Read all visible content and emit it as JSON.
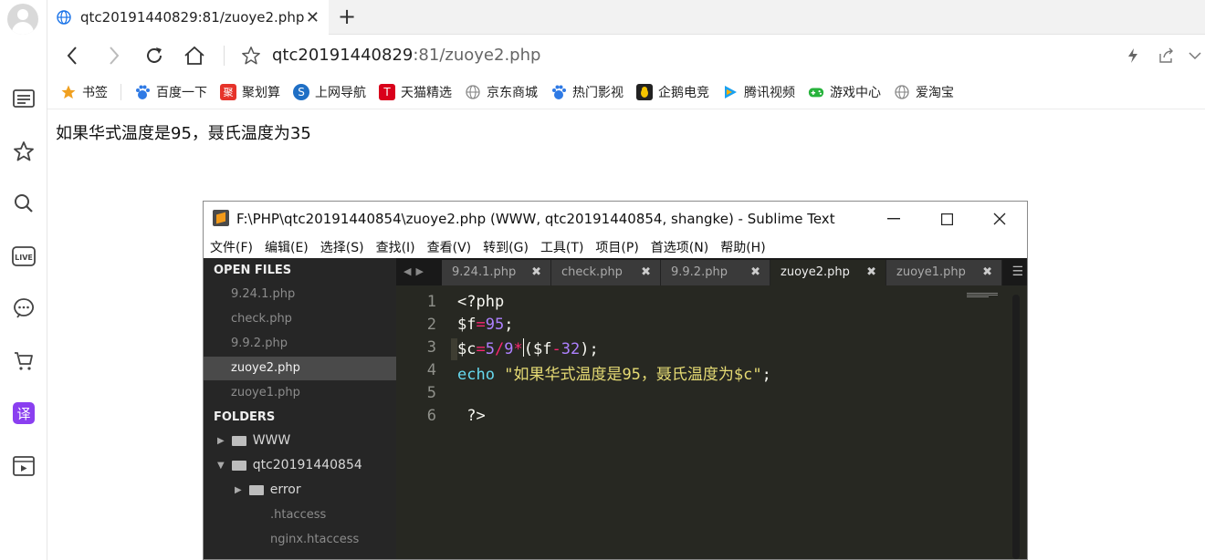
{
  "browser": {
    "tab_title": "qtc20191440829:81/zuoye2.php",
    "close_glyph": "✕",
    "new_tab_glyph": "+",
    "address_host": "qtc20191440829",
    "address_rest": ":81/zuoye2.php"
  },
  "bookmarks": [
    {
      "label": "书签",
      "icon": "star-icon",
      "color": "#f0a020"
    },
    {
      "label": "百度一下",
      "icon": "baidu-icon",
      "color": "#2f7ae5"
    },
    {
      "label": "聚划算",
      "icon": "juhuasuan-icon",
      "color": "#e6332a"
    },
    {
      "label": "上网导航",
      "icon": "nav-icon",
      "color": "#1f6fc5"
    },
    {
      "label": "天猫精选",
      "icon": "tmall-icon",
      "color": "#d9001b"
    },
    {
      "label": "京东商城",
      "icon": "globe-icon",
      "color": "#888888"
    },
    {
      "label": "热门影视",
      "icon": "baidu-icon",
      "color": "#2f7ae5"
    },
    {
      "label": "企鹅电竞",
      "icon": "penguin-icon",
      "color": "#222222"
    },
    {
      "label": "腾讯视频",
      "icon": "video-icon",
      "color": "#1aa1f0"
    },
    {
      "label": "游戏中心",
      "icon": "gamepad-icon",
      "color": "#27b33c"
    },
    {
      "label": "爱淘宝",
      "icon": "globe-icon",
      "color": "#888888"
    }
  ],
  "page": {
    "output_text": "如果华式温度是95，聂氏温度为35"
  },
  "sublime": {
    "title": "F:\\PHP\\qtc20191440854\\zuoye2.php (WWW, qtc20191440854, shangke) - Sublime Text",
    "menu": [
      "文件(F)",
      "编辑(E)",
      "选择(S)",
      "查找(I)",
      "查看(V)",
      "转到(G)",
      "工具(T)",
      "项目(P)",
      "首选项(N)",
      "帮助(H)"
    ],
    "sidebar": {
      "open_files_header": "OPEN FILES",
      "open_files": [
        "9.24.1.php",
        "check.php",
        "9.9.2.php",
        "zuoye2.php",
        "zuoye1.php"
      ],
      "folders_header": "FOLDERS",
      "folders": [
        "WWW",
        "qtc20191440854",
        "error"
      ],
      "files": [
        ".htaccess",
        "nginx.htaccess"
      ]
    },
    "tabs": [
      "9.24.1.php",
      "check.php",
      "9.9.2.php",
      "zuoye2.php",
      "zuoye1.php"
    ],
    "active_tab": "zuoye2.php",
    "line_numbers": [
      "1",
      "2",
      "3",
      "4",
      "5",
      "6"
    ],
    "code": {
      "l1": "<?php",
      "l2_var": "$f",
      "l2_eq": "=",
      "l2_num": "95",
      "l2_end": ";",
      "l3_var": "$c",
      "l3_eq": "=",
      "l3_a": "5",
      "l3_div": "/",
      "l3_b": "9",
      "l3_mul": "*",
      "l3_paren_open": "(",
      "l3_var2": "$f",
      "l3_minus": "-",
      "l3_c": "32",
      "l3_end": ");",
      "l4_kw": "echo",
      "l4_str": "\"如果华式温度是95，聂氏温度为$c\"",
      "l4_end": ";",
      "l6": " ?>"
    },
    "colors": {
      "bg": "#272822",
      "keyword": "#66d9ef",
      "operator": "#f92672",
      "number": "#ae81ff",
      "string": "#e6db74",
      "text": "#f8f8f2"
    }
  }
}
